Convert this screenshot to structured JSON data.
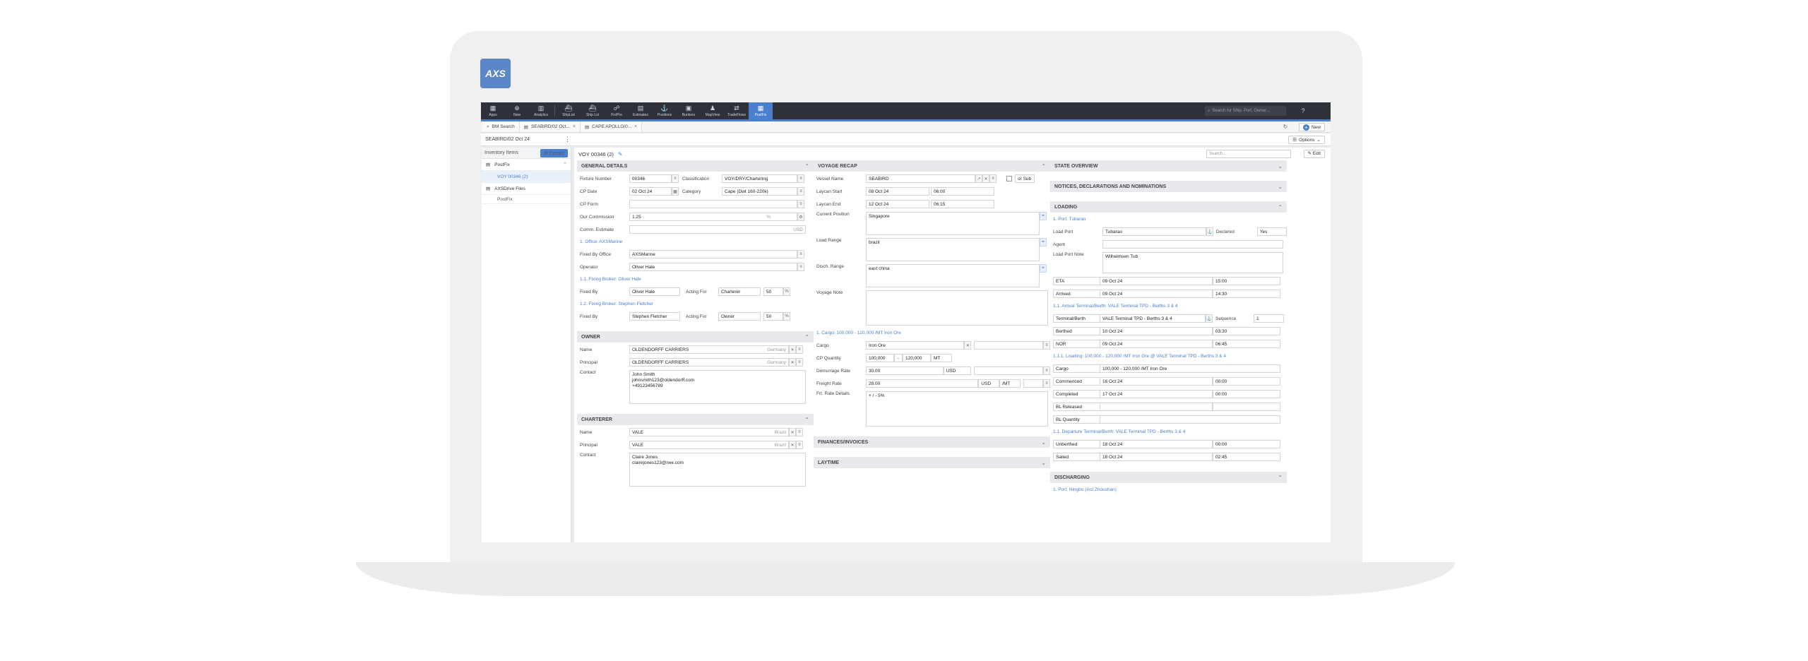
{
  "app": {
    "logo": "AXS"
  },
  "topbar": {
    "items": [
      {
        "label": "Apps",
        "icon": "grid-icon",
        "glyph": "▦"
      },
      {
        "label": "New",
        "icon": "plus-circle-icon",
        "glyph": "⊕"
      },
      {
        "label": "Analytics",
        "icon": "chart-icon",
        "glyph": "▥"
      },
      {
        "label": "ShipList",
        "icon": "ship-icon",
        "glyph": "⛴"
      },
      {
        "label": "Ship Lst",
        "icon": "ship-list-icon",
        "glyph": "⛴"
      },
      {
        "label": "Fix/Prs",
        "icon": "handshake-icon",
        "glyph": "☍"
      },
      {
        "label": "Estimates",
        "icon": "calculator-icon",
        "glyph": "▤"
      },
      {
        "label": "Positions",
        "icon": "anchor-icon",
        "glyph": "⚓"
      },
      {
        "label": "Bunkers",
        "icon": "fuel-icon",
        "glyph": "▣"
      },
      {
        "label": "MapView",
        "icon": "person-icon",
        "glyph": "♟"
      },
      {
        "label": "TradeFlows",
        "icon": "flow-icon",
        "glyph": "⇄"
      },
      {
        "label": "PostFix",
        "icon": "calendar-icon",
        "glyph": "▦"
      }
    ],
    "search_placeholder": "Search for Ship, Port, Owner...",
    "help": "?"
  },
  "tabs": [
    {
      "label": "BM Search",
      "icon": "search-icon",
      "glyph": "⌕"
    },
    {
      "label": "SEABIRD/02 Oct...",
      "icon": "doc-icon",
      "glyph": "▤"
    },
    {
      "label": "CAPE APOLLO/0...",
      "icon": "doc-icon",
      "glyph": "▤"
    }
  ],
  "new_button": "New",
  "breadcrumb": "SEABIRD/02 Oct 24",
  "options_button": "Options",
  "sidebar": {
    "title": "Inventory Items",
    "create": "Create",
    "items": [
      {
        "label": "PostFix",
        "type": "parent"
      },
      {
        "label": "VOY 00346 (2)",
        "type": "child"
      },
      {
        "label": "AXSDrive Files",
        "type": "parent"
      },
      {
        "label": "PostFix",
        "type": "sub"
      }
    ]
  },
  "main": {
    "voyage_title": "VOY 00346 (2)",
    "search_placeholder": "Search...",
    "edit": "Edit"
  },
  "general": {
    "title": "GENERAL DETAILS",
    "fixture_number_label": "Fixture Number",
    "fixture_number": "00346",
    "classification_label": "Classification",
    "classification": "VOY/DRY/Chartering",
    "cp_date_label": "CP Date",
    "cp_date": "02 Oct 24",
    "category_label": "Category",
    "category": "Cape (Dwt 160-220k)",
    "cp_form_label": "CP Form",
    "cp_form": "",
    "commission_label": "Our Commission",
    "commission": "1.25",
    "commission_unit": "%",
    "comm_estimate_label": "Comm. Estimate",
    "comm_estimate_unit": "USD",
    "office_heading": "1. Office: AXSMarine",
    "fixed_by_office_label": "Fixed By Office",
    "fixed_by_office": "AXSMarine",
    "operator_label": "Operator",
    "operator": "Oliver Hale",
    "broker1_heading": "1.1. Fixing Broker: Oliver Hale",
    "fixed_by_label": "Fixed By",
    "fixed_by_1": "Oliver Hale",
    "acting_for_label": "Acting For",
    "acting_for_1": "Charterer",
    "pct_1": "50",
    "pct_unit": "%",
    "broker2_heading": "1.2. Fixing Broker: Stephen Fletcher",
    "fixed_by_2": "Stephen Fletcher",
    "acting_for_2": "Owner",
    "pct_2": "50"
  },
  "owner": {
    "title": "OWNER",
    "name_label": "Name",
    "name": "OLDENDORFF CARRIERS",
    "name_country": "Germany",
    "principal_label": "Principal",
    "principal": "OLDENDORFF CARRIERS",
    "principal_country": "Germany",
    "contact_label": "Contact",
    "contact_lines": [
      "John Smith",
      "johnsmith123@oldendorff.com",
      "+49123456789"
    ]
  },
  "charterer": {
    "title": "CHARTERER",
    "name_label": "Name",
    "name": "VALE",
    "name_country": "Brazil",
    "principal_label": "Principal",
    "principal": "VALE",
    "principal_country": "Brazil",
    "contact_label": "Contact",
    "contact_lines": [
      "Claire Jones",
      "clairejones123@rwe.com"
    ]
  },
  "recap": {
    "title": "VOYAGE RECAP",
    "vessel_label": "Vessel Name",
    "vessel": "SEABIRD",
    "or_sub": "or Sub",
    "laycan_start_label": "Laycan Start",
    "laycan_start_date": "08 Oct 24",
    "laycan_start_time": "06:00",
    "laycan_end_label": "Laycan End",
    "laycan_end_date": "12 Oct 24",
    "laycan_end_time": "06:15",
    "position_label": "Current Position",
    "position": "Singapore",
    "load_range_label": "Load Range",
    "load_range": "brazil",
    "disch_range_label": "Disch. Range",
    "disch_range": "east china",
    "voyage_note_label": "Voyage Note",
    "cargo_heading": "1. Cargo: 100,000 - 120,000 /MT Iron Ore",
    "cargo_label": "Cargo",
    "cargo": "Iron Ore",
    "cp_qty_label": "CP Quantity",
    "cp_qty_min": "100,000",
    "cp_qty_dash": "-",
    "cp_qty_max": "120,000",
    "cp_qty_unit": "MT",
    "demurrage_label": "Demurrage Rate",
    "demurrage": "30.00",
    "demurrage_unit": "USD",
    "freight_label": "Freight Rate",
    "freight": "28.00",
    "freight_ccy": "USD",
    "freight_unit": "/MT",
    "frt_details_label": "Frt. Rate Details",
    "frt_details": "+ / - 5%"
  },
  "finances": {
    "title": "FINANCES/INVOICES"
  },
  "laytime": {
    "title": "LAYTIME"
  },
  "state": {
    "title": "STATE OVERVIEW"
  },
  "notices": {
    "title": "NOTICES, DECLARATIONS AND NOMINATIONS"
  },
  "loading": {
    "title": "LOADING",
    "port_heading": "1. Port: Tubarao",
    "load_port_label": "Load Port",
    "load_port": "Tubarao",
    "declared_label": "Declared",
    "declared": "Yes",
    "agent_label": "Agent",
    "load_port_note_label": "Load Port Note",
    "load_port_note": "Wilhelmsen Tub",
    "eta_label": "ETA",
    "eta_date": "09 Oct 24",
    "eta_time": "15:00",
    "arrived_label": "Arrived",
    "arrived_date": "09 Oct 24",
    "arrived_time": "14:30",
    "arrival_heading": "1.1. Arrival Terminal/Berth: VALE Terminal TPD - Berths 3 & 4",
    "terminal_label": "Terminal/Berth",
    "terminal": "VALE Terminal TPD - Berths 3 & 4",
    "sequence_label": "Sequence",
    "sequence": "1",
    "berthed_label": "Berthed",
    "berthed_date": "10 Oct 24",
    "berthed_time": "03:30",
    "nor_label": "NOR",
    "nor_date": "09 Oct 24",
    "nor_time": "06:45",
    "loading_heading": "1.1.1. Loading: 100,000 - 120,000 /MT Iron Ore @ VALE Terminal TPD - Berths 3 & 4",
    "cargo_label": "Cargo",
    "cargo": "100,000 - 120,000 /MT Iron Ore",
    "commenced_label": "Commenced",
    "commenced_date": "16 Oct 24",
    "commenced_time": "00:00",
    "completed_label": "Completed",
    "completed_date": "17 Oct 24",
    "completed_time": "00:00",
    "bl_released_label": "BL Released",
    "bl_qty_label": "BL Quantity",
    "departure_heading": "1.1. Departure Terminal/Berth: VALE Terminal TPD - Berths 3 & 4",
    "unberthed_label": "Unberthed",
    "unberthed_date": "18 Oct 24",
    "unberthed_time": "00:00",
    "sailed_label": "Sailed",
    "sailed_date": "18 Oct 24",
    "sailed_time": "02:45"
  },
  "discharging": {
    "title": "DISCHARGING",
    "port_heading": "1. Port: Ningbo (incl Zhoushan)"
  }
}
